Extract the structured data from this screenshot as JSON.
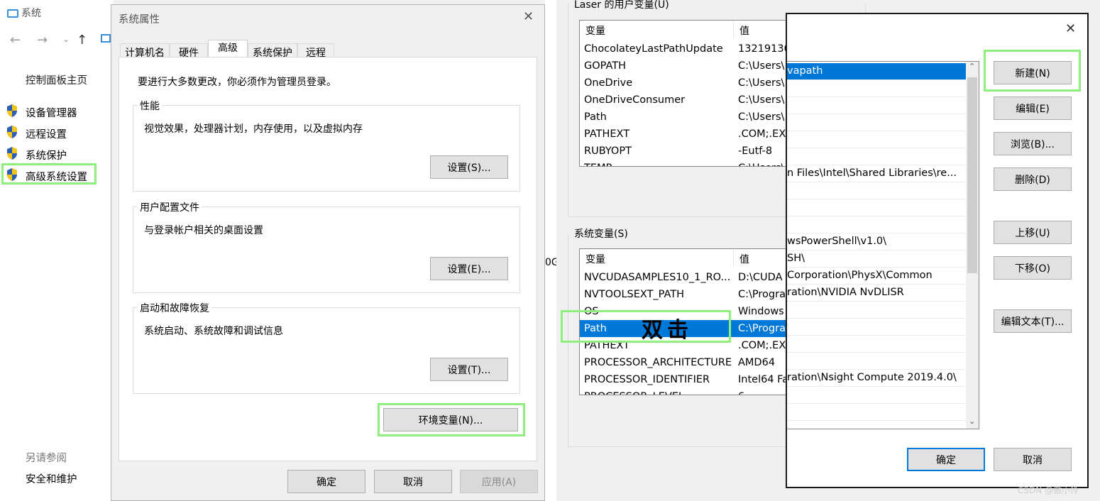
{
  "system_window": {
    "title": "系统",
    "sidebar": {
      "home": "控制面板主页",
      "items": [
        {
          "label": "设备管理器"
        },
        {
          "label": "远程设置"
        },
        {
          "label": "系统保护"
        },
        {
          "label": "高级系统设置"
        }
      ],
      "see_also": "另请参阅",
      "security": "安全和维护"
    },
    "partial_text": "0G"
  },
  "sysprops": {
    "title": "系统属性",
    "tabs": [
      "计算机名",
      "硬件",
      "高级",
      "系统保护",
      "远程"
    ],
    "active_tab": "高级",
    "admin_notice": "要进行大多数更改，你必须作为管理员登录。",
    "performance": {
      "title": "性能",
      "desc": "视觉效果，处理器计划，内存使用，以及虚拟内存",
      "button": "设置(S)..."
    },
    "profiles": {
      "title": "用户配置文件",
      "desc": "与登录帐户相关的桌面设置",
      "button": "设置(E)..."
    },
    "startup": {
      "title": "启动和故障恢复",
      "desc": "系统启动、系统故障和调试信息",
      "button": "设置(T)..."
    },
    "env_button": "环境变量(N)...",
    "ok": "确定",
    "cancel": "取消",
    "apply": "应用(A)"
  },
  "envvars": {
    "user_section": "Laser 的用户变量(U)",
    "system_section": "系统变量(S)",
    "col_name": "变量",
    "col_value": "值",
    "user_vars": [
      {
        "name": "ChocolateyLastPathUpdate",
        "value": "13219130"
      },
      {
        "name": "GOPATH",
        "value": "C:\\Users\\"
      },
      {
        "name": "OneDrive",
        "value": "C:\\Users\\"
      },
      {
        "name": "OneDriveConsumer",
        "value": "C:\\Users\\"
      },
      {
        "name": "Path",
        "value": "C:\\Users\\"
      },
      {
        "name": "PATHEXT",
        "value": ".COM;.EX"
      },
      {
        "name": "RUBYOPT",
        "value": "-Eutf-8"
      },
      {
        "name": "TEMP",
        "value": "C:\\Users\\"
      }
    ],
    "system_vars": [
      {
        "name": "NVCUDASAMPLES10_1_RO...",
        "value": "D:\\CUDA"
      },
      {
        "name": "NVTOOLSEXT_PATH",
        "value": "C:\\Progra"
      },
      {
        "name": "OS",
        "value": "Windows"
      },
      {
        "name": "Path",
        "value": "C:\\Progra"
      },
      {
        "name": "PATHEXT",
        "value": ".COM;.EX"
      },
      {
        "name": "PROCESSOR_ARCHITECTURE",
        "value": "AMD64"
      },
      {
        "name": "PROCESSOR_IDENTIFIER",
        "value": "Intel64 Fa"
      },
      {
        "name": "PROCESSOR_LEVEL",
        "value": "6"
      }
    ],
    "annotation": "双击"
  },
  "editpath": {
    "entries": [
      "vapath",
      "",
      "",
      "",
      "",
      "",
      "n Files\\Intel\\Shared Libraries\\re...",
      "",
      "",
      "",
      "wsPowerShell\\v1.0\\",
      "SH\\",
      "Corporation\\PhysX\\Common",
      "ration\\NVIDIA NvDLISR",
      "",
      "",
      "",
      "",
      "ration\\Nsight Compute 2019.4.0\\",
      "",
      ""
    ],
    "buttons": {
      "new": "新建(N)",
      "edit": "编辑(E)",
      "browse": "浏览(B)...",
      "delete": "删除(D)",
      "up": "上移(U)",
      "down": "下移(O)",
      "edit_text": "编辑文本(T)..."
    },
    "ok": "确定",
    "cancel": "取消"
  },
  "watermark": "CSDN @傲小怜"
}
